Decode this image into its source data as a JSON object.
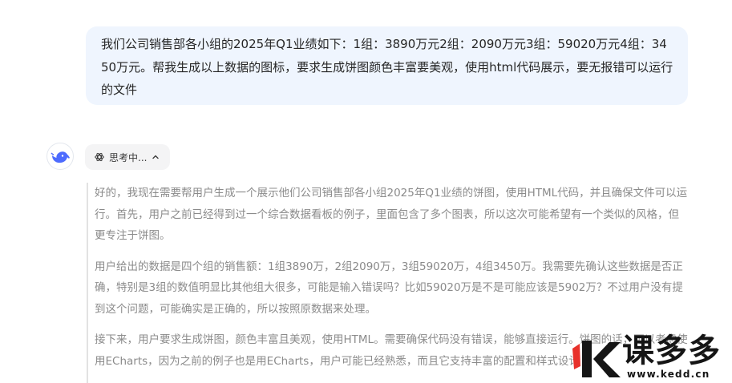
{
  "user_message": "我们公司销售部各小组的2025年Q1业绩如下：1组：3890万元2组：2090万元3组：59020万元4组：3450万元。帮我生成以上数据的图标，要求生成饼图颜色丰富要美观，使用html代码展示，要无报错可以运行的文件",
  "assistant": {
    "avatar_icon": "whale-logo-icon",
    "thinking_label": "思考中...",
    "thinking_toggle_icon": "chevron-up-icon",
    "thought_paragraphs": [
      "好的，我现在需要帮用户生成一个展示他们公司销售部各小组2025年Q1业绩的饼图，使用HTML代码，并且确保文件可以运行。首先，用户之前已经得到过一个综合数据看板的例子，里面包含了多个图表，所以这次可能希望有一个类似的风格，但更专注于饼图。",
      "用户给出的数据是四个组的销售额：1组3890万，2组2090万，3组59020万，4组3450万。我需要先确认这些数据是否正确，特别是3组的数值明显比其他组大很多，可能是输入错误吗？比如59020万是不是可能应该是5902万？不过用户没有提到这个问题，可能确实是正确的，所以按照原数据来处理。",
      "接下来，用户要求生成饼图，颜色丰富且美观，使用HTML。需要确保代码没有错误，能够直接运行。饼图的话，可以考虑使用ECharts，因为之前的例子也是用ECharts，用户可能已经熟悉，而且它支持丰富的配置和样式设计"
    ]
  },
  "watermark": {
    "brand": "课多多",
    "url": "www.kedd.cn",
    "colors": {
      "accent": "#e8312b",
      "text": "#151515"
    }
  },
  "colors": {
    "user_bubble_bg": "#eff5fe",
    "chip_bg": "#f4f4f5",
    "avatar_blue": "#4d6bfe",
    "thought_text": "#8b8b8b"
  }
}
